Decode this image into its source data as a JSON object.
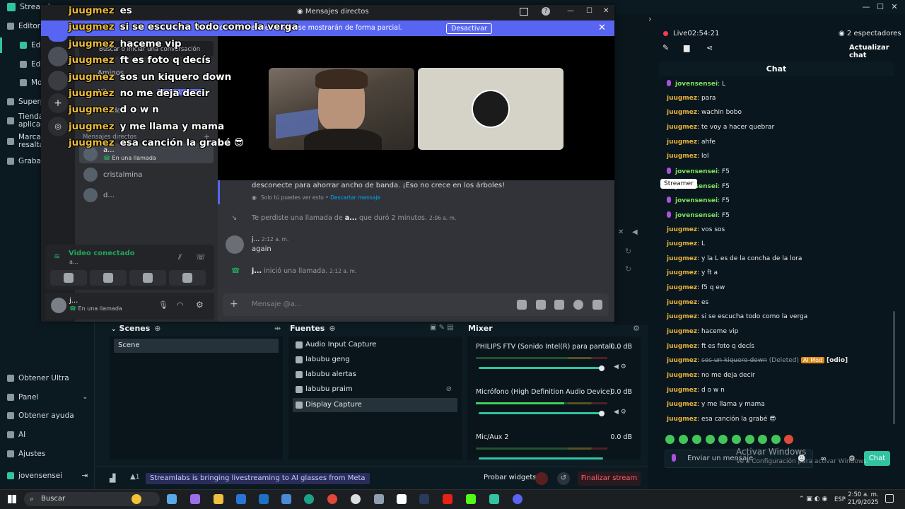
{
  "streamlabs": {
    "title": "Streamla",
    "sidebar": [
      {
        "label": "Editor"
      },
      {
        "label": "Edit"
      },
      {
        "label": "Edit"
      },
      {
        "label": "Mo"
      },
      {
        "label": "Superp"
      },
      {
        "label": "Tienda"
      },
      {
        "label": "aplicac"
      },
      {
        "label": "Marcad"
      },
      {
        "label": "resaltad"
      },
      {
        "label": "Grabaci"
      }
    ],
    "sidebar_bottom": [
      {
        "label": "Obtener Ultra"
      },
      {
        "label": "Panel"
      },
      {
        "label": "Obtener ayuda"
      },
      {
        "label": "AI"
      },
      {
        "label": "Ajustes"
      },
      {
        "label": "jovensensei"
      }
    ],
    "scenes": {
      "title": "Scenes",
      "items": [
        "Scene"
      ]
    },
    "sources": {
      "title": "Fuentes",
      "items": [
        "Audio Input Capture",
        "labubu geng",
        "labubu alertas",
        "labubu praim",
        "Display Capture"
      ]
    },
    "mixer": {
      "title": "Mixer",
      "channels": [
        {
          "name": "PHILIPS FTV (Sonido Intel(R) para pantall...",
          "db": "0.0 dB",
          "level": 0.0
        },
        {
          "name": "Micrófono (High Definition Audio Device)",
          "db": "0.0 dB",
          "level": 0.67
        },
        {
          "name": "Mic/Aux 2",
          "db": "0.0 dB",
          "level": 0.0
        }
      ]
    },
    "footer": {
      "alerts_count": "1",
      "banner": "Streamlabs is bringing livestreaming to AI glasses from Meta",
      "test_widgets": "Probar widgets",
      "end_stream": "Finalizar stream"
    }
  },
  "live": {
    "status": "Live",
    "time": "02:54:21",
    "viewers": "2 espectadores",
    "refresh_chat": "Actualizar chat",
    "chat_title": "Chat",
    "tooltip": "Streamer",
    "input_placeholder": "Enviar un mensaje",
    "send": "Chat",
    "messages": [
      {
        "user": "jovensensei",
        "text": "L",
        "streamer": true
      },
      {
        "user": "juugmez",
        "text": "para"
      },
      {
        "user": "juugmez",
        "text": "wachin bobo"
      },
      {
        "user": "juugmez",
        "text": "te voy a hacer quebrar"
      },
      {
        "user": "juugmez",
        "text": "ahfe"
      },
      {
        "user": "juugmez",
        "text": "lol"
      },
      {
        "user": "jovensensei",
        "text": "F5",
        "streamer": true
      },
      {
        "user": "jovensensei",
        "text": "F5",
        "streamer": true
      },
      {
        "user": "jovensensei",
        "text": "F5",
        "streamer": true
      },
      {
        "user": "jovensensei",
        "text": "F5",
        "streamer": true
      },
      {
        "user": "juugmez",
        "text": "vos sos"
      },
      {
        "user": "juugmez",
        "text": "L"
      },
      {
        "user": "juugmez",
        "text": "y la L es de la concha de la lora"
      },
      {
        "user": "juugmez",
        "text": "y ft a"
      },
      {
        "user": "juugmez",
        "text": "f5 q ew"
      },
      {
        "user": "juugmez",
        "text": "es"
      },
      {
        "user": "juugmez",
        "text": "si se escucha todo como la verga"
      },
      {
        "user": "juugmez",
        "text": "haceme vip"
      },
      {
        "user": "juugmez",
        "text": "ft es foto q decís"
      },
      {
        "user": "juugmez",
        "text": "sos un kiquero down",
        "deleted": true,
        "deleted_tag": "(Deleted)",
        "badge": "AI Mod",
        "reason": "[odio]"
      },
      {
        "user": "juugmez",
        "text": "no me deja decir"
      },
      {
        "user": "juugmez",
        "text": "d o w n"
      },
      {
        "user": "juugmez",
        "text": "y me llama y mama"
      },
      {
        "user": "juugmez",
        "text": "esa canción la grabé 😎"
      }
    ]
  },
  "windows_watermark": {
    "title": "Activar Windows",
    "subtitle": "Ve a Configuración para activar Windows."
  },
  "discord": {
    "title": "Mensajes directos",
    "banner_text": "vado. Los nombres de usuario se mostrarán de forma parcial.",
    "banner_button": "Desactivar",
    "search_placeholder": "Buscar o iniciar una conversación",
    "friends": "Amigos",
    "nitro": "Nitro",
    "nitro_badge": "PRUEBA GRATIS",
    "shop": "Tienda",
    "dm_header": "Mensajes directos",
    "dms": [
      {
        "name": "a...",
        "sub": "En una llamada"
      },
      {
        "name": "cristalmina",
        "sub": ""
      },
      {
        "name": "d...",
        "sub": ""
      }
    ],
    "messages": {
      "clyde_text": "desconecte para ahorrar ancho de banda. ¡Eso no crece en los árboles!",
      "clyde_note": "Solo tú puedes ver esto •",
      "clyde_dismiss": "Descartar mensaje",
      "missed_call_pre": "Te perdiste una llamada de",
      "missed_call_user": "a...",
      "missed_call_post": "que duró 2 minutos.",
      "missed_call_time": "2:06 a. m.",
      "author": "j...",
      "author_time": "2:12 a. m.",
      "author_text": "again",
      "started_call_user": "j...",
      "started_call_text": "inició una llamada.",
      "started_call_time": "2:12 a. m."
    },
    "input_placeholder": "Mensaje @a...",
    "voice_status": "Video conectado",
    "voice_channel": "a...",
    "user_name": "j...",
    "user_status": "En una llamada"
  },
  "overlay_chat": [
    {
      "user": "juugmez",
      "text": "es"
    },
    {
      "user": "juugmez",
      "text": "si se escucha todo como la verga"
    },
    {
      "user": "juugmez",
      "text": "haceme vip"
    },
    {
      "user": "juugmez",
      "text": "ft es foto q decís"
    },
    {
      "user": "juugmez",
      "text": "sos un kiquero down"
    },
    {
      "user": "juugmez",
      "text": "no me deja decir"
    },
    {
      "user": "juugmez",
      "text": "d o w n"
    },
    {
      "user": "juugmez",
      "text": "y me llama y mama"
    },
    {
      "user": "juugmez",
      "text": "esa canción la grabé 😎"
    }
  ],
  "taskbar": {
    "search": "Buscar",
    "lang": "ESP",
    "time": "2:50 a. m.",
    "date": "21/9/2025"
  },
  "colors": {
    "accent": "#31c3a2",
    "discord": "#5865f2",
    "user_viewer": "#e7b23a",
    "user_streamer": "#7ee05a",
    "live": "#ff3b4f"
  }
}
